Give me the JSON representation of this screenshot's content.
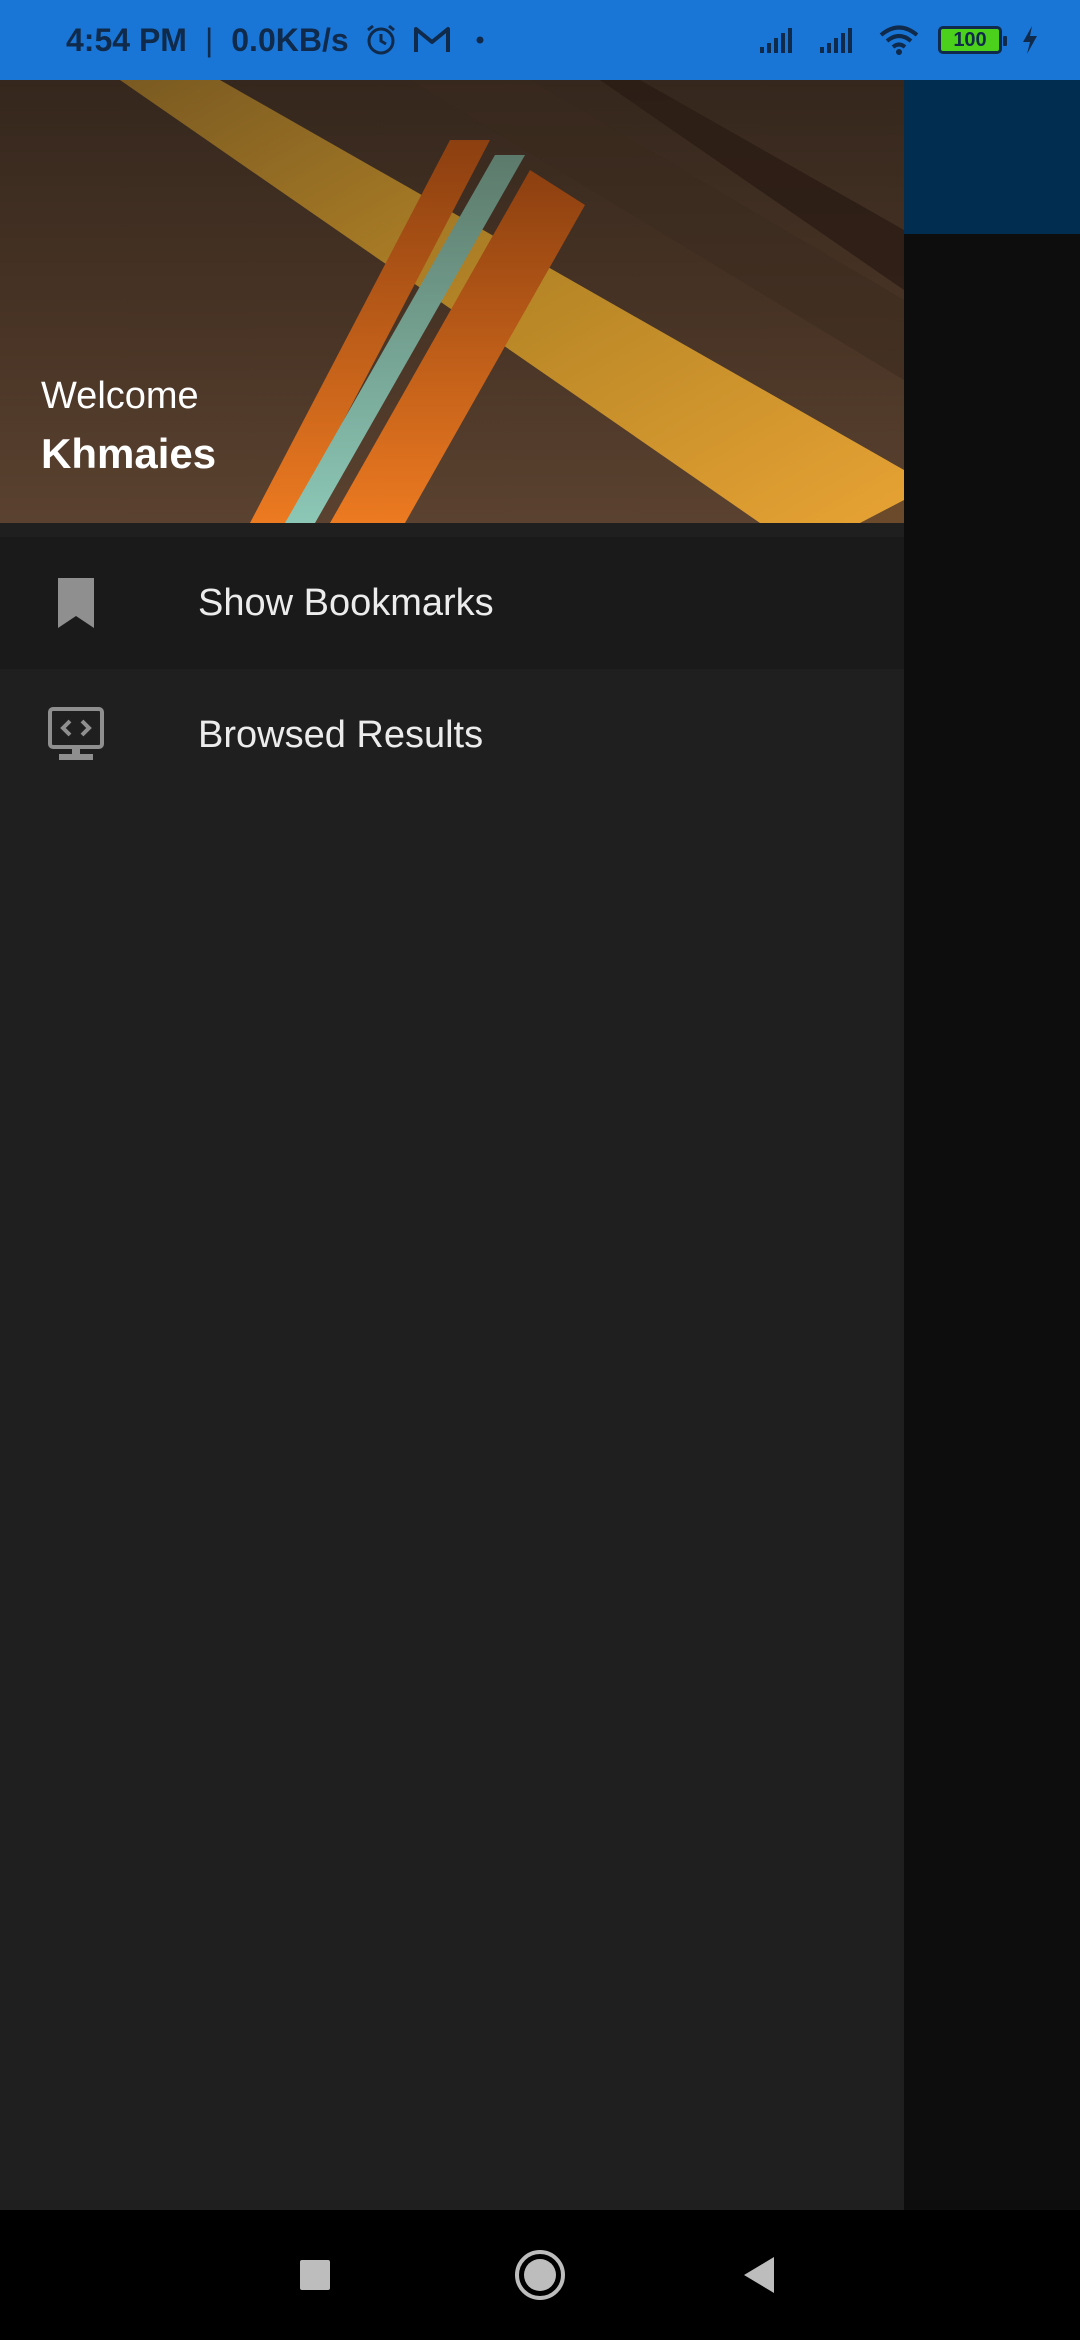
{
  "status_bar": {
    "time": "4:54 PM",
    "separator": "|",
    "network_speed": "0.0KB/s",
    "battery_level": "100",
    "icons": [
      "alarm-icon",
      "gmail-icon",
      "dot-icon",
      "signal-icon",
      "signal-icon",
      "wifi-icon",
      "battery-icon",
      "charging-icon"
    ]
  },
  "drawer": {
    "header": {
      "welcome": "Welcome",
      "user_name": "Khmaies"
    },
    "items": [
      {
        "label": "Show Bookmarks",
        "icon": "bookmark-icon",
        "selected": true
      },
      {
        "label": "Browsed Results",
        "icon": "code-monitor-icon",
        "selected": false
      }
    ]
  },
  "nav_bar": {
    "buttons": [
      "recents-button",
      "home-button",
      "back-button"
    ]
  },
  "colors": {
    "status_bar": "#1a76d6",
    "drawer_bg": "#1f1f1f",
    "selected_item_bg": "#1a1a1a",
    "background_appbar": "#012d51"
  }
}
